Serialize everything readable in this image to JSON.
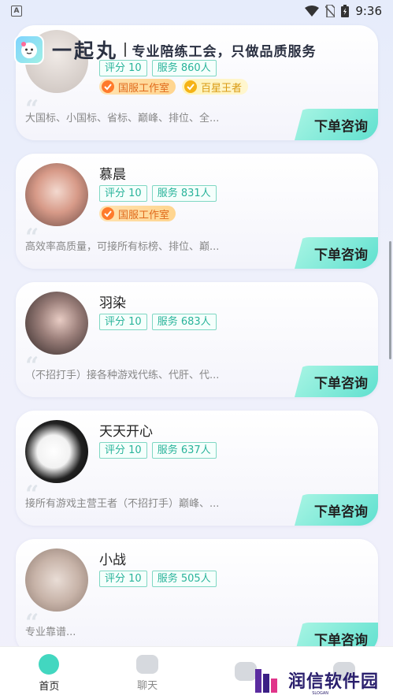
{
  "status_bar": {
    "time": "9:36"
  },
  "header": {
    "app_name": "一起丸",
    "slogan": "专业陪练工会，只做品质服务"
  },
  "cards": [
    {
      "name": "",
      "score": "评分 10",
      "service": "服务 860人",
      "badges": [
        "国服工作室",
        "百星王者"
      ],
      "desc": "大国标、小国标、省标、巅峰、排位、全...",
      "button": "下单咨询"
    },
    {
      "name": "慕晨",
      "score": "评分 10",
      "service": "服务 831人",
      "badges": [
        "国服工作室"
      ],
      "desc": "高效率高质量，可接所有标榜、排位、巅...",
      "button": "下单咨询"
    },
    {
      "name": "羽染",
      "score": "评分 10",
      "service": "服务 683人",
      "badges": [],
      "desc": "（不招打手）接各种游戏代练、代肝、代...",
      "button": "下单咨询"
    },
    {
      "name": "天天开心",
      "score": "评分 10",
      "service": "服务 637人",
      "badges": [],
      "desc": "接所有游戏主营王者（不招打手）巅峰、...",
      "button": "下单咨询"
    },
    {
      "name": "小战",
      "score": "评分 10",
      "service": "服务 505人",
      "badges": [],
      "desc": "专业靠谱...",
      "button": "下单咨询"
    }
  ],
  "tabbar": {
    "home": "首页",
    "chat": "聊天"
  },
  "watermark": {
    "text": "润信软件园",
    "sub": "SLOGAN"
  }
}
